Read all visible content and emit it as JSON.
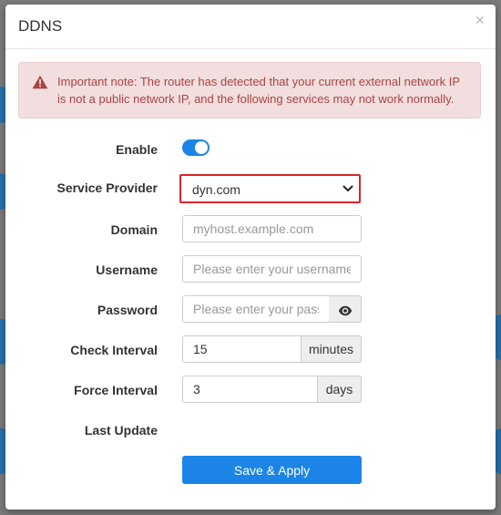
{
  "modal": {
    "title": "DDNS",
    "close_symbol": "×",
    "alert": {
      "icon": "warning-triangle-icon",
      "text": "Important note: The router has detected that your current external network IP is not a public network IP, and the following services may not work normally."
    },
    "form": {
      "enable": {
        "label": "Enable",
        "on": true
      },
      "service_provider": {
        "label": "Service Provider",
        "value": "dyn.com"
      },
      "domain": {
        "label": "Domain",
        "value": "",
        "placeholder": "myhost.example.com"
      },
      "username": {
        "label": "Username",
        "value": "",
        "placeholder": "Please enter your username"
      },
      "password": {
        "label": "Password",
        "value": "",
        "placeholder": "Please enter your password",
        "reveal_icon": "eye-icon"
      },
      "check_interval": {
        "label": "Check Interval",
        "value": "15",
        "unit": "minutes"
      },
      "force_interval": {
        "label": "Force Interval",
        "value": "3",
        "unit": "days"
      },
      "last_update": {
        "label": "Last Update",
        "value": ""
      }
    },
    "save_label": "Save & Apply"
  },
  "colors": {
    "accent": "#1c84e6",
    "alert_text": "#a94442",
    "alert_bg": "#f2dede",
    "highlight_border": "#d9252a"
  }
}
